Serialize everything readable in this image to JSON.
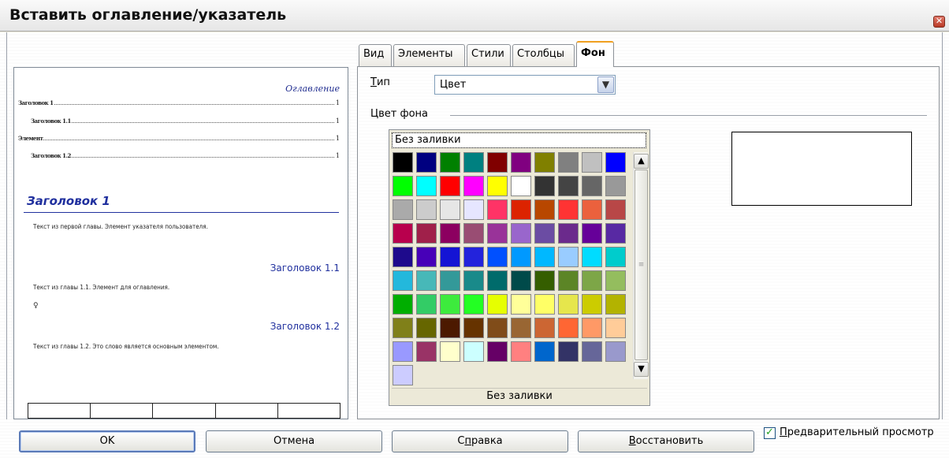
{
  "window": {
    "title": "Вставить оглавление/указатель",
    "close_icon": "close-icon"
  },
  "preview": {
    "toc_title": "Оглавление",
    "toc_entries": [
      {
        "label": "Заголовок 1",
        "page": "1"
      },
      {
        "label": "Заголовок 1.1",
        "page": "1"
      },
      {
        "label": "Элемент",
        "page": "1"
      },
      {
        "label": "Заголовок 1.2",
        "page": "1"
      }
    ],
    "heading1": "Заголовок 1",
    "text1": "Текст из первой главы. Элемент указателя пользователя.",
    "heading11": "Заголовок 1.1",
    "text11": "Текст из главы 1.1. Элемент для оглавления.",
    "heading12": "Заголовок 1.2",
    "text12": "Текст из главы 1.2. Это слово является основным элементом."
  },
  "tabs": [
    {
      "label": "Вид",
      "active": false
    },
    {
      "label": "Элементы",
      "active": false
    },
    {
      "label": "Стили",
      "active": false
    },
    {
      "label": "Столбцы",
      "active": false
    },
    {
      "label": "Фон",
      "active": true
    }
  ],
  "background": {
    "type_label": "Тип",
    "type_mnemonic": "Т",
    "type_label_rest": "ип",
    "type_value": "Цвет",
    "color_group_label": "Цвет фона",
    "no_fill_top": "Без заливки",
    "no_fill_bottom": "Без заливки",
    "palette_colors": [
      "#000000",
      "#000080",
      "#008000",
      "#008080",
      "#800000",
      "#800080",
      "#808000",
      "#808080",
      "#c0c0c0",
      "#0000ff",
      "#00ff00",
      "#00ffff",
      "#ff0000",
      "#ff00ff",
      "#ffff00",
      "#ffffff",
      "#333333",
      "#444444",
      "#666666",
      "#999999",
      "#aaaaaa",
      "#cccccc",
      "#e6e6e6",
      "#e6e6ff",
      "#ff3366",
      "#dc2300",
      "#b84700",
      "#ff3333",
      "#eb613d",
      "#b84747",
      "#b8004d",
      "#a0204a",
      "#8c0060",
      "#994d73",
      "#993399",
      "#9966cc",
      "#6b4ca3",
      "#6b2a8c",
      "#660099",
      "#5829a3",
      "#1e0a8c",
      "#4700b8",
      "#1414d4",
      "#2323dc",
      "#0050ff",
      "#0099ff",
      "#00b8ff",
      "#99ccff",
      "#00dcff",
      "#00cccc",
      "#23b8dc",
      "#47b8b8",
      "#339999",
      "#198a8a",
      "#006b6b",
      "#004a4a",
      "#355e00",
      "#5c8526",
      "#7da647",
      "#94bd5e",
      "#00ae00",
      "#33cc66",
      "#3deb3d",
      "#23ff23",
      "#e6ff00",
      "#ffff99",
      "#ffff66",
      "#e6e64c",
      "#cccc00",
      "#b3b300",
      "#808019",
      "#666600",
      "#4c1900",
      "#663300",
      "#804c19",
      "#996633",
      "#cc6633",
      "#ff6633",
      "#ff9966",
      "#ffcc99",
      "#9999ff",
      "#993366",
      "#ffffcc",
      "#ccffff",
      "#660066",
      "#ff8080",
      "#0066cc",
      "#333366",
      "#666699",
      "#9999cc",
      "#ccccff"
    ]
  },
  "buttons": {
    "ok": "OK",
    "cancel": "Отмена",
    "help": "Справка",
    "help_pre": "С",
    "help_mn": "п",
    "help_post": "равка",
    "reset": "Восстановить",
    "reset_mn": "В",
    "reset_post": "осстановить"
  },
  "preview_checkbox": {
    "label": "Предварительный просмотр",
    "mn": "П",
    "rest": "редварительный просмотр",
    "checked": true
  }
}
